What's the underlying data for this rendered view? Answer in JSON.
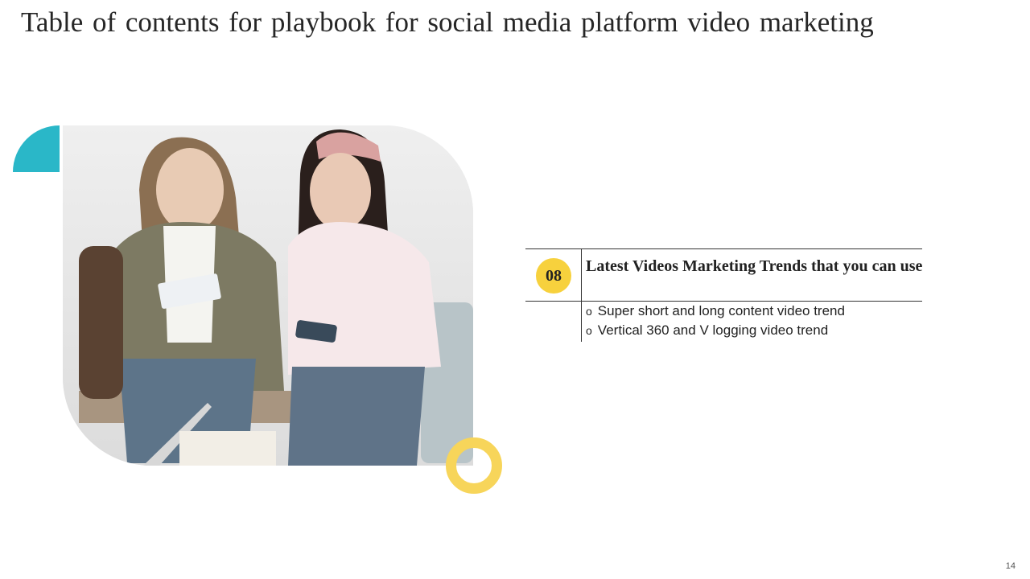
{
  "slide": {
    "title": "Table of contents for playbook for social media platform video marketing",
    "page_number": "14"
  },
  "section": {
    "number": "08",
    "title": "Latest Videos Marketing Trends that you can use",
    "items": [
      "Super short and long content video trend",
      "Vertical 360 and V logging video trend"
    ],
    "bullet": "o"
  },
  "colors": {
    "accent_teal": "#2ab7c8",
    "accent_yellow": "#f7d13d"
  },
  "image": {
    "subject": "photo-two-women-with-phones"
  }
}
